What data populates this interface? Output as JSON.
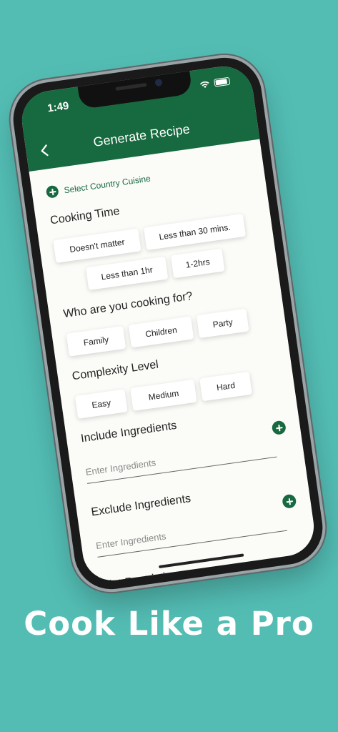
{
  "colors": {
    "background": "#53bdb4",
    "brand_green": "#17693f"
  },
  "status_bar": {
    "time": "1:49",
    "icons": [
      "wifi-icon",
      "battery-icon"
    ]
  },
  "header": {
    "title": "Generate Recipe",
    "back_icon": "chevron-left-icon"
  },
  "cuisine": {
    "label": "Select Country Cuisine",
    "icon": "plus-circle-icon"
  },
  "cooking_time": {
    "title": "Cooking Time",
    "options": [
      "Doesn't matter",
      "Less than 30 mins.",
      "Less than 1hr",
      "1-2hrs"
    ]
  },
  "audience": {
    "title": "Who are you cooking for?",
    "options": [
      "Family",
      "Children",
      "Party"
    ]
  },
  "complexity": {
    "title": "Complexity Level",
    "options": [
      "Easy",
      "Medium",
      "Hard"
    ]
  },
  "include_ingredients": {
    "title": "Include Ingredients",
    "placeholder": "Enter Ingredients"
  },
  "exclude_ingredients": {
    "title": "Exclude Ingredients",
    "placeholder": "Enter Ingredients"
  },
  "diet_restrictions": {
    "title": "Diet Restrictions"
  },
  "tagline": "Cook Like a Pro"
}
